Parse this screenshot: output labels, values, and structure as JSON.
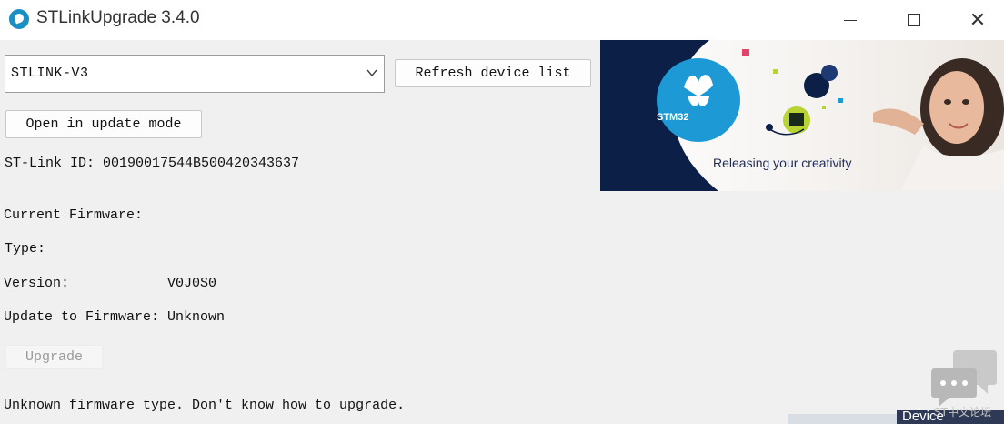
{
  "window": {
    "title": "STLinkUpgrade 3.4.0",
    "controls": [
      "minimize",
      "maximize",
      "close"
    ]
  },
  "device_selector": {
    "selected": "STLINK-V3",
    "refresh_label": "Refresh device list"
  },
  "update_mode_label": "Open in update mode",
  "stlink_id": {
    "label": "ST-Link ID:",
    "value": "00190017544B500420343637"
  },
  "firmware": {
    "current_label": "Current Firmware:",
    "type_label": "Type:",
    "type_value": "",
    "version_label": "Version:",
    "version_value": "V0J0S0",
    "update_to_label": "Update to Firmware:",
    "update_to_value": "Unknown"
  },
  "upgrade_label": "Upgrade",
  "status_message": "Unknown firmware type. Don't know how to upgrade.",
  "banner": {
    "logo_text": "STM32",
    "tagline": "Releasing your creativity"
  },
  "watermark_text": "ST中文论坛",
  "background_window_text": "Device",
  "colors": {
    "window_bg": "#f0f0f0",
    "banner_navy": "#0b1f47",
    "stm32_blue": "#1d9ad6",
    "accent_green": "#b8d432"
  }
}
